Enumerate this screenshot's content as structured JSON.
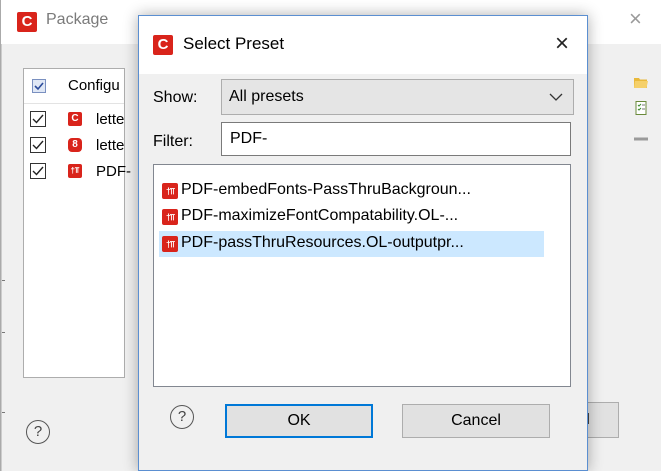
{
  "background_window": {
    "title": "Package",
    "column_header": "Configu",
    "rows": [
      {
        "label": "lette",
        "checked": true,
        "icon": "connect-c-icon"
      },
      {
        "label": "lette",
        "checked": true,
        "icon": "connect-template-icon"
      },
      {
        "label": "PDF-",
        "checked": true,
        "icon": "preset-icon"
      }
    ],
    "cancel_label_partial": "el",
    "help_glyph": "?"
  },
  "dialog": {
    "title": "Select Preset",
    "close_glyph": "×",
    "show_label": "Show:",
    "show_value": "All presets",
    "filter_label": "Filter:",
    "filter_value": "PDF-",
    "presets": [
      {
        "label": "PDF-embedFonts-PassThruBackgroun...",
        "selected": false
      },
      {
        "label": "PDF-maximizeFontCompatability.OL-...",
        "selected": false
      },
      {
        "label": "PDF-passThruResources.OL-outputpr...",
        "selected": true
      }
    ],
    "help_glyph": "?",
    "ok_label": "OK",
    "cancel_label": "Cancel"
  },
  "colors": {
    "brand_red": "#d9241b",
    "selection": "#cce8ff",
    "focus_blue": "#0078d7"
  }
}
